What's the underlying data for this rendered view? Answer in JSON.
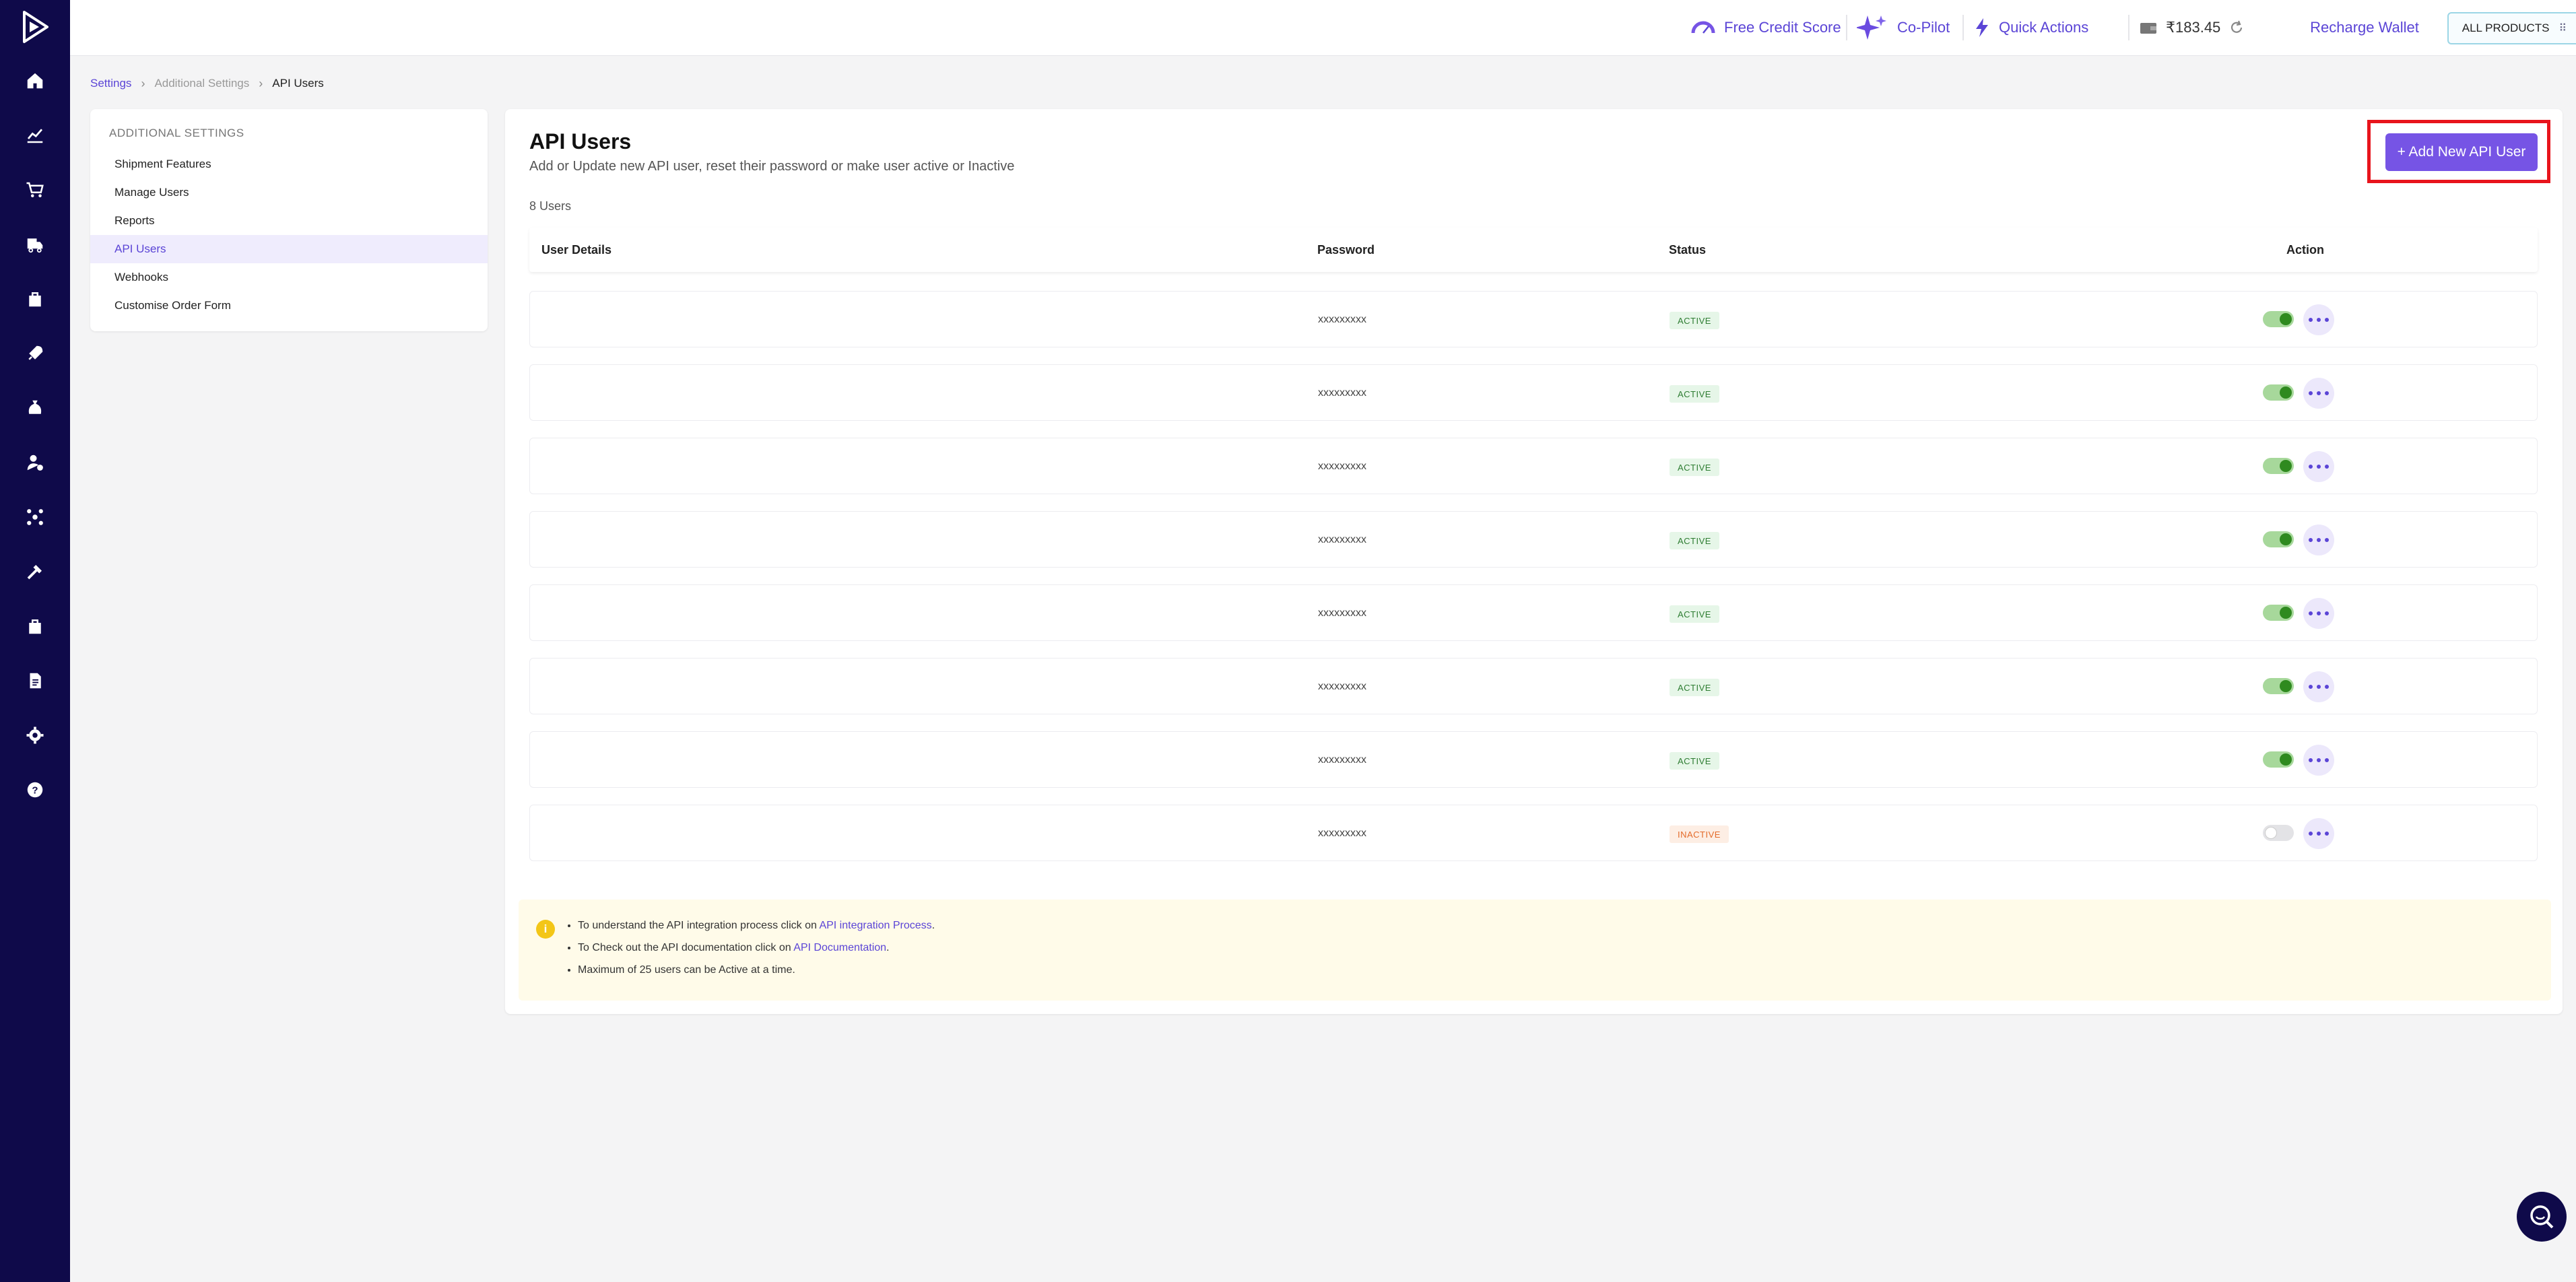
{
  "topbar": {
    "credit_score": "Free Credit Score",
    "copilot": "Co-Pilot",
    "quick_actions": "Quick Actions",
    "wallet_balance": "₹183.45",
    "recharge": "Recharge Wallet",
    "all_products": "ALL PRODUCTS"
  },
  "breadcrumb": {
    "settings": "Settings",
    "additional": "Additional Settings",
    "current": "API Users"
  },
  "settings_panel": {
    "heading": "ADDITIONAL SETTINGS",
    "items": [
      {
        "label": "Shipment Features"
      },
      {
        "label": "Manage Users"
      },
      {
        "label": "Reports"
      },
      {
        "label": "API Users"
      },
      {
        "label": "Webhooks"
      },
      {
        "label": "Customise Order Form"
      }
    ]
  },
  "main": {
    "title": "API Users",
    "subtitle": "Add or Update new API user, reset their password or make user active or Inactive",
    "count": "8 Users",
    "add_button": "+ Add New API User",
    "columns": {
      "user_details": "User Details",
      "password": "Password",
      "status": "Status",
      "action": "Action"
    },
    "rows": [
      {
        "password": "xxxxxxxxx",
        "status": "ACTIVE"
      },
      {
        "password": "xxxxxxxxx",
        "status": "ACTIVE"
      },
      {
        "password": "xxxxxxxxx",
        "status": "ACTIVE"
      },
      {
        "password": "xxxxxxxxx",
        "status": "ACTIVE"
      },
      {
        "password": "xxxxxxxxx",
        "status": "ACTIVE"
      },
      {
        "password": "xxxxxxxxx",
        "status": "ACTIVE"
      },
      {
        "password": "xxxxxxxxx",
        "status": "ACTIVE"
      },
      {
        "password": "xxxxxxxxx",
        "status": "INACTIVE"
      }
    ]
  },
  "info": {
    "line1_prefix": "To understand the API integration process click on ",
    "line1_link": "API integration Process",
    "line1_suffix": ".",
    "line2_prefix": "To Check out the API documentation click on ",
    "line2_link": "API Documentation",
    "line2_suffix": ".",
    "line3": "Maximum of 25 users can be Active at a time."
  },
  "colors": {
    "sidebar": "#0f0a4a",
    "accent": "#7654e5",
    "link": "#5b45d6",
    "highlight_border": "#e8141c"
  }
}
